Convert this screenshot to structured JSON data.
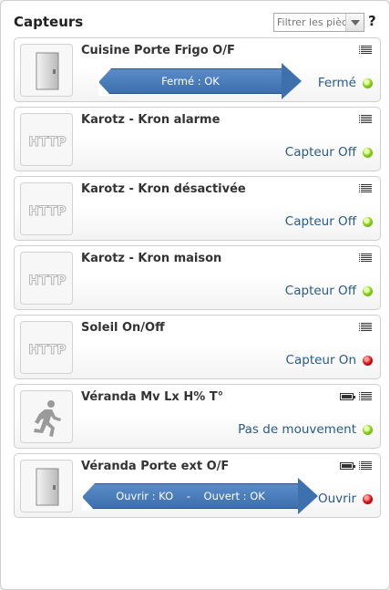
{
  "panel": {
    "title": "Capteurs",
    "filter_placeholder": "Filtrer les pièces",
    "help_label": "?"
  },
  "sensors": [
    {
      "name": "Cuisine Porte Frigo O/F",
      "icon": "door-icon",
      "status": "Fermé",
      "status_color": "green",
      "battery": false
    },
    {
      "name": "Karotz - Kron alarme",
      "icon": "http-icon",
      "status": "Capteur Off",
      "status_color": "green",
      "battery": false
    },
    {
      "name": "Karotz - Kron désactivée",
      "icon": "http-icon",
      "status": "Capteur Off",
      "status_color": "green",
      "battery": false
    },
    {
      "name": "Karotz - Kron maison",
      "icon": "http-icon",
      "status": "Capteur Off",
      "status_color": "green",
      "battery": false
    },
    {
      "name": "Soleil On/Off",
      "icon": "http-icon",
      "status": "Capteur On",
      "status_color": "red",
      "battery": false
    },
    {
      "name": "Véranda Mv Lx H% T°",
      "icon": "running-person-icon",
      "status": "Pas de mouvement",
      "status_color": "green",
      "battery": true
    },
    {
      "name": "Véranda Porte ext O/F",
      "icon": "door-icon",
      "status": "Ouvrir",
      "status_color": "red",
      "battery": true
    }
  ],
  "annotations": [
    {
      "text": "Fermé : OK"
    },
    {
      "text": "Ouvrir : KO    -    Ouvert : OK"
    }
  ],
  "icon_text": {
    "http": "HTTP"
  },
  "colors": {
    "status_text": "#2a5a86",
    "green": "#8ed21b",
    "red": "#d31010",
    "arrow": "#4a7cbb"
  }
}
